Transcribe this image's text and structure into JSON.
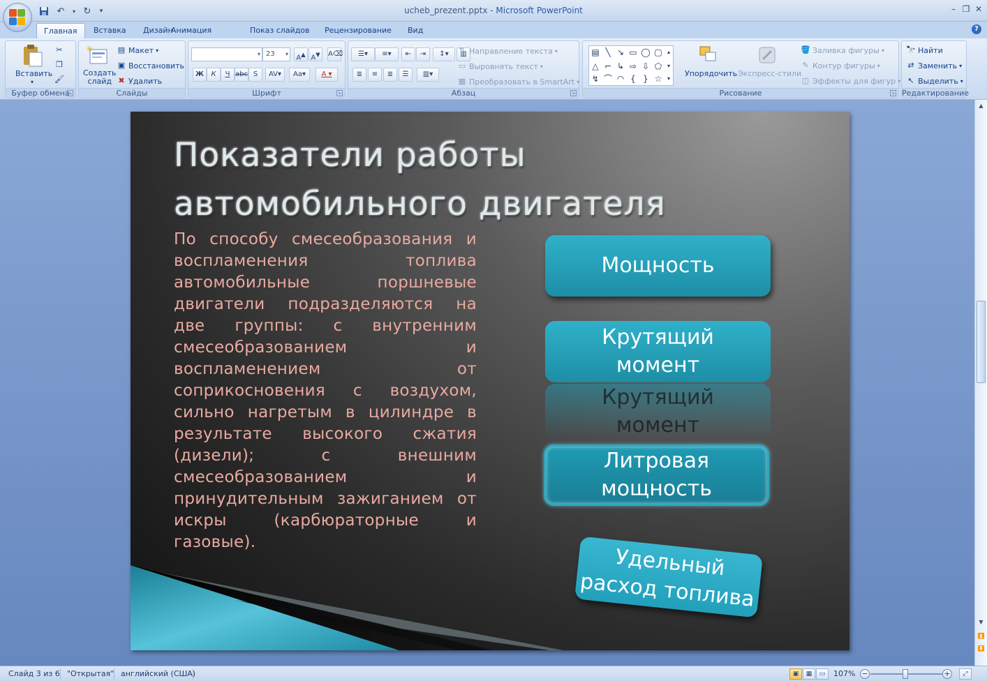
{
  "window": {
    "file_name": "ucheb_prezent.pptx",
    "separator": " - ",
    "app_name": "Microsoft PowerPoint"
  },
  "tabs": [
    "Главная",
    "Вставка",
    "Дизайн",
    "Анимация",
    "Показ слайдов",
    "Рецензирование",
    "Вид"
  ],
  "ribbon": {
    "clipboard": {
      "label": "Буфер обмена",
      "paste": "Вставить"
    },
    "slides": {
      "label": "Слайды",
      "new_slide_line1": "Создать",
      "new_slide_line2": "слайд",
      "layout": "Макет",
      "reset": "Восстановить",
      "delete": "Удалить"
    },
    "font": {
      "label": "Шрифт",
      "font_name": "",
      "font_size": "23"
    },
    "paragraph": {
      "label": "Абзац",
      "text_direction": "Направление текста",
      "align_text": "Выровнять текст",
      "smartart": "Преобразовать в SmartArt"
    },
    "drawing": {
      "label": "Рисование",
      "arrange": "Упорядочить",
      "quick_styles": "Экспресс-стили",
      "shape_fill": "Заливка фигуры",
      "shape_outline": "Контур фигуры",
      "shape_effects": "Эффекты для фигур"
    },
    "editing": {
      "label": "Редактирование",
      "find": "Найти",
      "replace": "Заменить",
      "select": "Выделить"
    }
  },
  "slide": {
    "title_line1": "Показатели работы",
    "title_line2": "автомобильного двигателя",
    "body": "По способу смесеобразования и воспламенения топлива автомобильные поршневые двигатели подразделяются на две группы: с внутренним смесеобразованием и воспламенением от соприкосновения с воздухом, сильно нагретым в цилиндре в результате высокого сжатия (дизели); с внешним смесеобразованием и принудительным зажиганием от искры (карбюраторные и газовые).",
    "shapes": {
      "power": "Мощность",
      "torque_line1": "Крутящий",
      "torque_line2": "момент",
      "liter_line1": "Литровая",
      "liter_line2": "мощность",
      "fuel_line1": "Удельный",
      "fuel_line2": "расход топлива"
    }
  },
  "status": {
    "slide_info": "Слайд 3 из 6",
    "theme": "\"Открытая\"",
    "language": "английский (США)",
    "zoom": "107%"
  },
  "colors": {
    "accent": "#1d8ea6",
    "body_text": "#e9a9a0",
    "title_text": "#dfe9ec"
  }
}
